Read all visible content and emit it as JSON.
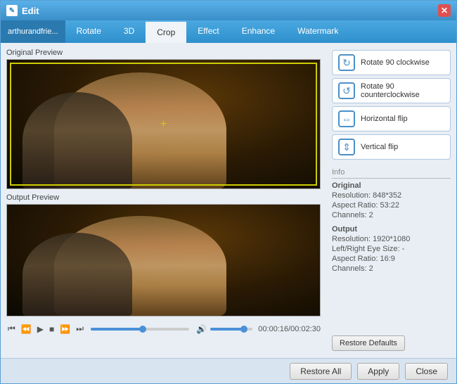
{
  "window": {
    "title": "Edit",
    "close_label": "✕"
  },
  "tabs": {
    "file_tab_label": "arthurandfrie...",
    "items": [
      {
        "id": "rotate",
        "label": "Rotate",
        "active": false
      },
      {
        "id": "3d",
        "label": "3D",
        "active": false
      },
      {
        "id": "crop",
        "label": "Crop",
        "active": true
      },
      {
        "id": "effect",
        "label": "Effect",
        "active": false
      },
      {
        "id": "enhance",
        "label": "Enhance",
        "active": false
      },
      {
        "id": "watermark",
        "label": "Watermark",
        "active": false
      }
    ]
  },
  "panels": {
    "original_preview_label": "Original Preview",
    "output_preview_label": "Output Preview"
  },
  "actions": [
    {
      "id": "rotate_cw",
      "label": "Rotate 90 clockwise",
      "icon": "↻"
    },
    {
      "id": "rotate_ccw",
      "label": "Rotate 90 counterclockwise",
      "icon": "↺"
    },
    {
      "id": "h_flip",
      "label": "Horizontal flip",
      "icon": "⇔"
    },
    {
      "id": "v_flip",
      "label": "Vertical flip",
      "icon": "⇕"
    }
  ],
  "playback": {
    "time_current": "00:00:16",
    "time_total": "00:02:30",
    "time_separator": "/"
  },
  "info": {
    "section_label": "Info",
    "original_label": "Original",
    "original_resolution": "Resolution: 848*352",
    "original_aspect": "Aspect Ratio: 53:22",
    "original_channels": "Channels: 2",
    "output_label": "Output",
    "output_resolution": "Resolution: 1920*1080",
    "output_left_right": "Left/Right Eye Size: -",
    "output_aspect": "Aspect Ratio: 16:9",
    "output_channels": "Channels: 2"
  },
  "buttons": {
    "restore_defaults": "Restore Defaults",
    "restore_all": "Restore All",
    "apply": "Apply",
    "close": "Close"
  },
  "colors": {
    "accent": "#4a90d8",
    "tab_bar": "#3a9ad8",
    "active_tab": "#f0f4f8"
  }
}
